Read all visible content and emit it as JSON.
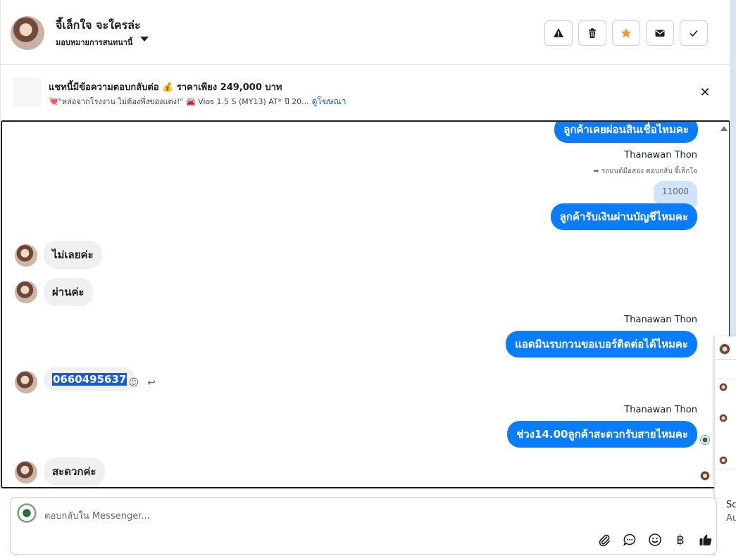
{
  "header": {
    "title": "จี้เล็กใจ จะใครล่ะ",
    "subtitle": "มอบหมายการสนทนานี้",
    "buttons": [
      "spam-warning",
      "delete",
      "star",
      "mark-unread",
      "done"
    ],
    "star_color": "#f7923b"
  },
  "ad": {
    "title": "แชทนี้มีข้อความตอบกลับต่อ 💰 ราคาเพียง 249,000 บาท",
    "subtitle": "💘\"หล่อจากโรงงาน ไม่ต้องพึ่งของแต่ง!\" 🚘 Vios 1.5 S (MY13) AT* ปี 20...",
    "link": "ดูโฆษณา"
  },
  "chat": {
    "messages": [
      {
        "dir": "out",
        "text": "ลูกค้าเคยผ่อนสินเชื่อไหมคะ"
      },
      {
        "dir": "out",
        "sender": "Thanawan Thon",
        "reply_note": "รถยนต์มือสอง ตอบกลับ จี้เล็กใจ",
        "quote": "11000",
        "text": "ลูกค้ารับเงินผ่านบัญชีไหมคะ"
      },
      {
        "dir": "in",
        "text": "ไม่เลยค่ะ"
      },
      {
        "dir": "in",
        "text": "ผ่านค่ะ"
      },
      {
        "dir": "out",
        "sender": "Thanawan Thon",
        "text": "แอดมินรบกวนขอเบอร์ติดต่อได้ไหมคะ"
      },
      {
        "dir": "in",
        "text": "0660495637"
      },
      {
        "dir": "out",
        "sender": "Thanawan Thon",
        "text": "ช่วง14.00ลูกค้าสะดวกรับสายไหมคะ"
      },
      {
        "dir": "in",
        "text": "สะดวกค่ะ"
      }
    ],
    "outgoing_color": "#0a7cff",
    "incoming_color": "#f0f0f0"
  },
  "side_panel": {
    "line1": "Sc",
    "line2": "Au"
  },
  "composer": {
    "placeholder": "ตอบกลับใน Messenger...",
    "icons": [
      "attach-icon",
      "saved-reply-icon",
      "emoji-icon",
      "baht-icon",
      "thumbs-up-icon"
    ],
    "currency_glyph": "฿"
  }
}
